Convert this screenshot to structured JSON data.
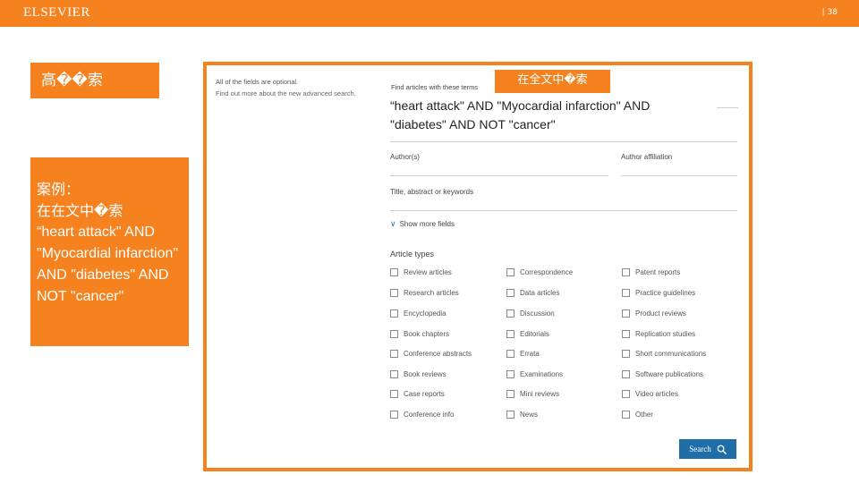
{
  "header": {
    "brand": "ELSEVIER",
    "page_number": "| 38"
  },
  "title_box": {
    "text": "高��索"
  },
  "case_box": {
    "title_lines": [
      "案例：",
      "在在文中�索"
    ],
    "text": "“heart attack\" AND \"Myocardial infarction\" AND \"diabetes\" AND NOT \"cancer\""
  },
  "search_form": {
    "hint_line1": "All of the fields are optional.",
    "hint_line2": "Find out more about the new advanced search.",
    "find_label": "Find articles with these terms",
    "badge": "在全文中�索",
    "query": "“heart attack\" AND \"Myocardial infarction\" AND \"diabetes\" AND NOT \"cancer\"",
    "author_label": "Author(s)",
    "affiliation_label": "Author affiliation",
    "title_keywords_label": "Title, abstract or keywords",
    "show_more": "Show more fields",
    "article_types_title": "Article types",
    "article_types": [
      [
        "Review articles",
        "Correspondence",
        "Patent reports"
      ],
      [
        "Research articles",
        "Data articles",
        "Practice guidelines"
      ],
      [
        "Encyclopedia",
        "Discussion",
        "Product reviews"
      ],
      [
        "Book chapters",
        "Editorials",
        "Replication studies"
      ],
      [
        "Conference abstracts",
        "Errata",
        "Short communications"
      ],
      [
        "Book reviews",
        "Examinations",
        "Software publications"
      ],
      [
        "Case reports",
        "Mini reviews",
        "Video articles"
      ],
      [
        "Conference info",
        "News",
        "Other"
      ]
    ],
    "search_button": "Search"
  },
  "colors": {
    "accent": "#f5821f",
    "button": "#1f6ea8"
  }
}
